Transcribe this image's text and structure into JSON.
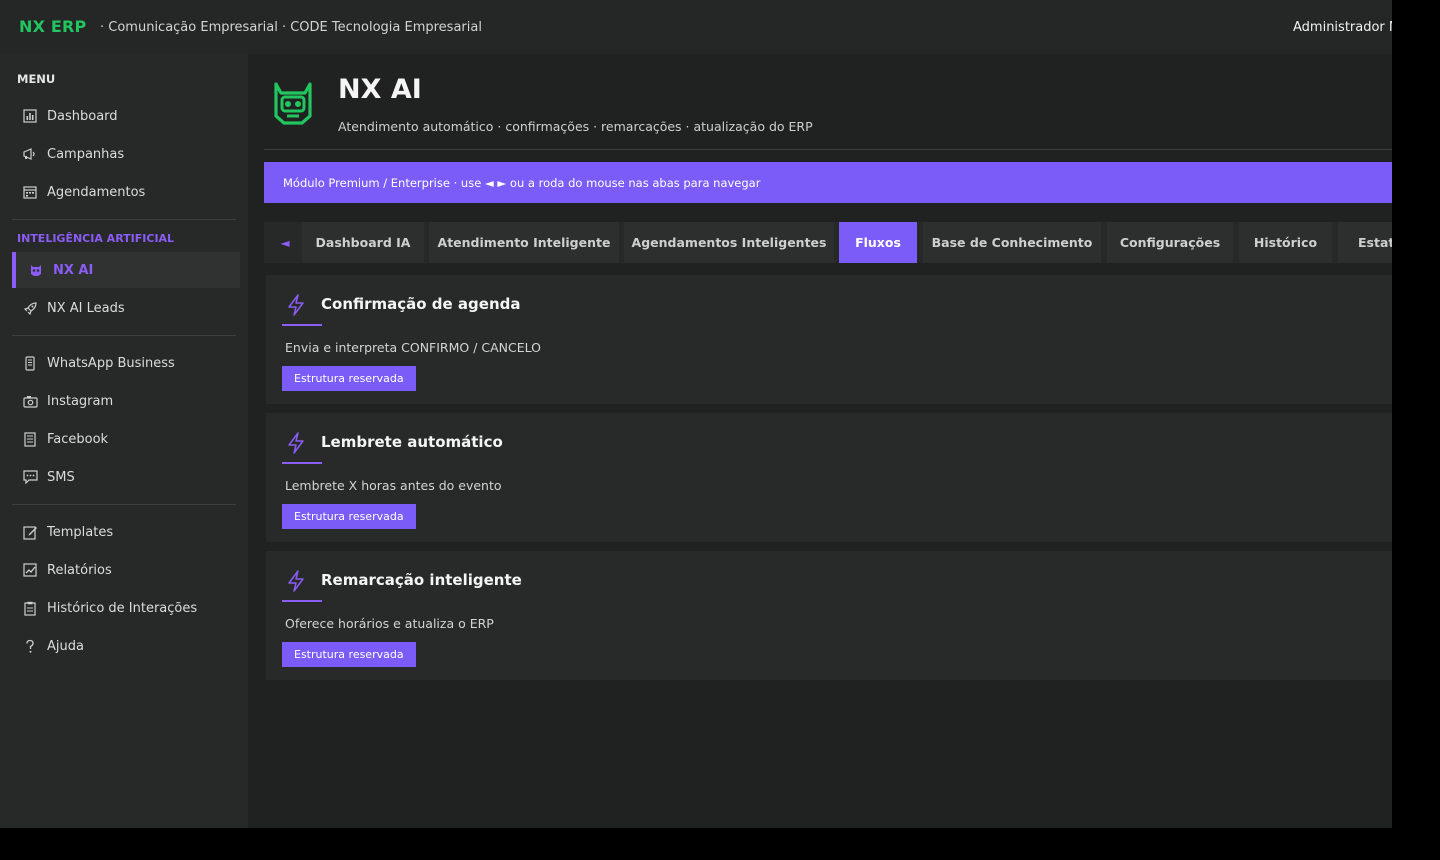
{
  "header": {
    "logo": "NX ERP",
    "subtitle": "· Comunicação Empresarial · CODE Tecnologia Empresarial",
    "user": "Administrador M"
  },
  "sidebar": {
    "menu_title": "MENU",
    "items_top": [
      {
        "label": "Dashboard",
        "icon": "bar-chart-icon"
      },
      {
        "label": "Campanhas",
        "icon": "megaphone-icon"
      },
      {
        "label": "Agendamentos",
        "icon": "calendar-icon"
      }
    ],
    "ai_section_title": "INTELIGÊNCIA ARTIFICIAL",
    "items_ai": [
      {
        "label": "NX AI",
        "icon": "robot-icon",
        "active": true
      },
      {
        "label": "NX AI Leads",
        "icon": "rocket-icon"
      }
    ],
    "items_channels": [
      {
        "label": "WhatsApp Business",
        "icon": "phone-icon"
      },
      {
        "label": "Instagram",
        "icon": "camera-icon"
      },
      {
        "label": "Facebook",
        "icon": "book-icon"
      },
      {
        "label": "SMS",
        "icon": "chat-icon"
      }
    ],
    "items_tools": [
      {
        "label": "Templates",
        "icon": "edit-icon"
      },
      {
        "label": "Relatórios",
        "icon": "chart-check-icon"
      },
      {
        "label": "Histórico de Interações",
        "icon": "clipboard-icon"
      },
      {
        "label": "Ajuda",
        "icon": "help-icon"
      }
    ]
  },
  "page": {
    "title": "NX AI",
    "subtitle": "Atendimento automático · confirmações · remarcações · atualização do ERP",
    "banner": "Módulo Premium / Enterprise · use ◄ ► ou a roda do mouse nas abas para navegar"
  },
  "tabs": {
    "left_arrow": "◄",
    "items": [
      {
        "label": "Dashboard IA"
      },
      {
        "label": "Atendimento Inteligente"
      },
      {
        "label": "Agendamentos Inteligentes"
      },
      {
        "label": "Fluxos",
        "active": true
      },
      {
        "label": "Base de Conhecimento"
      },
      {
        "label": "Configurações"
      },
      {
        "label": "Histórico"
      },
      {
        "label": "Estat"
      }
    ]
  },
  "flows": [
    {
      "title": "Confirmação de agenda",
      "description": "Envia e interpreta CONFIRMO / CANCELO",
      "button": "Estrutura reservada"
    },
    {
      "title": "Lembrete automático",
      "description": "Lembrete X horas antes do evento",
      "button": "Estrutura reservada"
    },
    {
      "title": "Remarcação inteligente",
      "description": "Oferece horários e atualiza o ERP",
      "button": "Estrutura reservada"
    }
  ],
  "colors": {
    "accent": "#7c5cf8",
    "brand_green": "#22c55e",
    "background": "#1f2221",
    "sidebar": "#262928"
  }
}
